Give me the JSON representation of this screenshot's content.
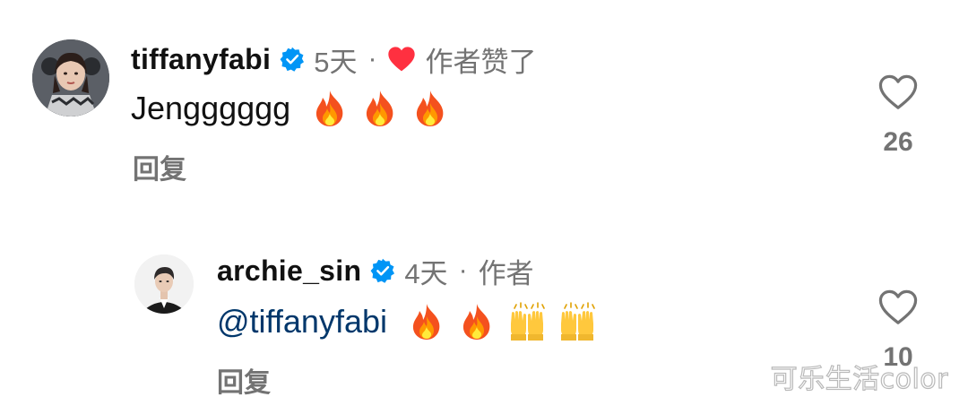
{
  "comments": [
    {
      "username": "tiffanyfabi",
      "time": "5天",
      "separator": "·",
      "author_status": "作者赞了",
      "text": "Jengggggg",
      "emoji": [
        "fire",
        "fire",
        "fire"
      ],
      "reply_label": "回复",
      "like_count": "26"
    },
    {
      "username": "archie_sin",
      "time": "4天",
      "separator": "·",
      "author_status": "作者",
      "mention": "@tiffanyfabi",
      "emoji": [
        "fire",
        "fire",
        "raising-hands",
        "raising-hands"
      ],
      "reply_label": "回复",
      "like_count": "10"
    }
  ],
  "watermark": "可乐生活color",
  "colors": {
    "text": "#111111",
    "meta": "#737373",
    "verified": "#0095f6",
    "heart_red": "#ff3040",
    "mention": "#00376b"
  }
}
